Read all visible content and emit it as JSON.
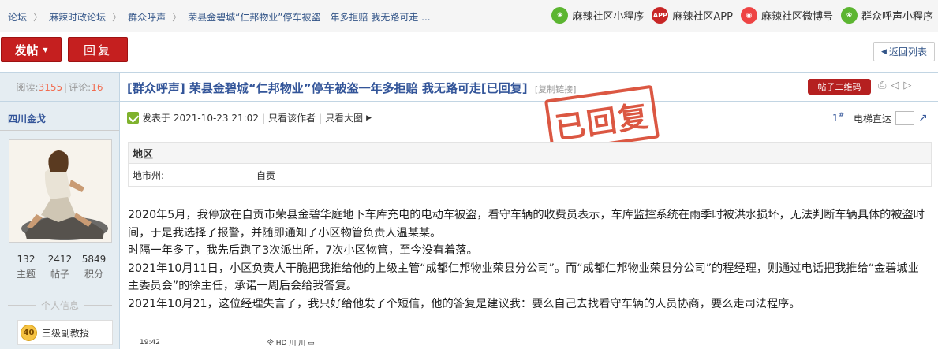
{
  "breadcrumb": [
    "论坛",
    "麻辣时政论坛",
    "群众呼声",
    "荣县金碧城“仁邦物业”停车被盗一年多拒赔 我无路可走 ..."
  ],
  "quicklinks": [
    {
      "label": "麻辣社区小程序",
      "icon": "wechat-miniprogram-icon",
      "glyph": "❀"
    },
    {
      "label": "麻辣社区APP",
      "icon": "app-icon",
      "glyph": "APP"
    },
    {
      "label": "麻辣社区微博号",
      "icon": "weibo-icon",
      "glyph": "◉"
    },
    {
      "label": "群众呼声小程序",
      "icon": "wechat-miniprogram-icon",
      "glyph": "❀"
    }
  ],
  "actions": {
    "post": "发帖",
    "reply": "回复",
    "back": "返回列表"
  },
  "thread": {
    "views_label": "阅读:",
    "views": "3155",
    "replies_label": "评论:",
    "replies": "16",
    "title": "[群众呼声] 荣县金碧城“仁邦物业”停车被盗一年多拒赔 我无路可走[已回复]",
    "copy_link": "[复制链接]",
    "qr": "帖子二维码"
  },
  "author": {
    "name": "四川金戈",
    "stats": [
      {
        "value": "132",
        "label": "主题"
      },
      {
        "value": "2412",
        "label": "帖子"
      },
      {
        "value": "5849",
        "label": "积分"
      }
    ],
    "personal_info": "个人信息",
    "level": "40",
    "rank": "三级副教授"
  },
  "post": {
    "posted_at": "发表于 2021-10-23 21:02",
    "only_author": "只看该作者",
    "only_images": "只看大图",
    "floor": "1",
    "floor_sup": "#",
    "elevator": "电梯直达",
    "stamp": "已回复"
  },
  "region": {
    "heading": "地区",
    "key": "地市州:",
    "value": "自贡"
  },
  "content": [
    "2020年5月，我停放在自贡市荣县金碧华庭地下车库充电的电动车被盗，看守车辆的收费员表示，车库监控系统在雨季时被洪水损坏，无法判断车辆具体的被盗时间，于是我选择了报警，并随即通知了小区物管负责人温某某。",
    "时隔一年多了，我先后跑了3次派出所，7次小区物管，至今没有着落。",
    "2021年10月11日，小区负责人干脆把我推给他的上级主管“成都仁邦物业荣县分公司”。而“成都仁邦物业荣县分公司”的程经理，则通过电话把我推给“金碧城业主委员会”的徐主任，承诺一周后会给我答复。",
    "2021年10月21，这位经理失言了，我只好给他发了个短信，他的答复是建议我：要么自己去找看守车辆的人员协商，要么走司法程序。"
  ],
  "preview": {
    "time": "19:42",
    "status": "令 HD 川 川 ▭"
  }
}
